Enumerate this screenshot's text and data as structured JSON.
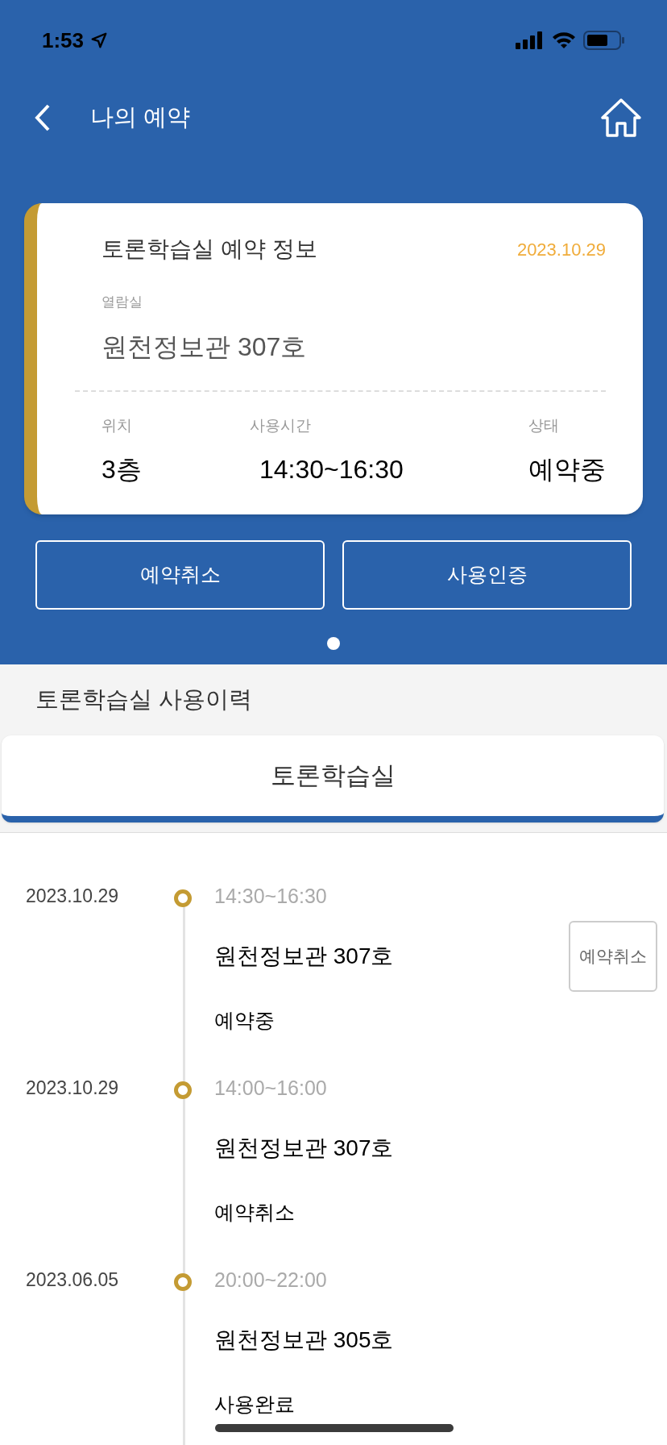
{
  "status_bar": {
    "time": "1:53"
  },
  "header": {
    "title": "나의 예약"
  },
  "reservation_card": {
    "title": "토론학습실 예약 정보",
    "date": "2023.10.29",
    "room_label": "열람실",
    "room": "원천정보관 307호",
    "fields": [
      {
        "label": "위치",
        "value": "3층"
      },
      {
        "label": "사용시간",
        "value": "14:30~16:30"
      },
      {
        "label": "상태",
        "value": "예약중"
      }
    ]
  },
  "actions": [
    "예약취소",
    "사용인증"
  ],
  "pager": [
    {
      "selected": true
    }
  ],
  "history": {
    "title": "토론학습실 사용이력",
    "tabs": [
      {
        "label": "토론학습실",
        "selected": true
      }
    ],
    "items": [
      {
        "date": "2023.10.29",
        "time": "14:30~16:30",
        "room": "원천정보관 307호",
        "status": "예약중",
        "action": "예약취소"
      },
      {
        "date": "2023.10.29",
        "time": "14:00~16:00",
        "room": "원천정보관 307호",
        "status": "예약취소"
      },
      {
        "date": "2023.06.05",
        "time": "20:00~22:00",
        "room": "원천정보관 305호",
        "status": "사용완료"
      }
    ]
  }
}
